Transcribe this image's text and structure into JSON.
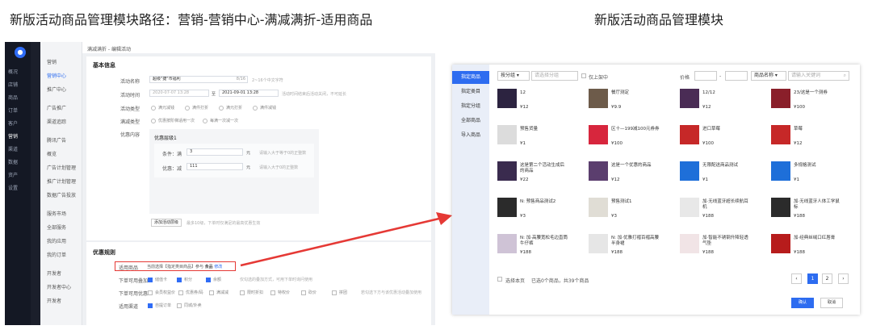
{
  "titles": {
    "left": "新版活动商品管理模块路径：营销-营销中心-满减满折-适用商品",
    "right": "新版活动商品管理模块"
  },
  "left": {
    "nav": [
      "概况",
      "店铺",
      "商品",
      "订单",
      "客户",
      "营销",
      "渠道",
      "数据",
      "资产",
      "设置"
    ],
    "nav_active": 5,
    "sub": [
      "营销",
      "营销中心",
      "推广中心",
      "广告推广",
      "渠道追踪",
      "腾讯广告",
      "概览",
      "广告计划管理",
      "推广计划管理",
      "数据广告投放",
      "服务市场",
      "全部服务",
      "我的应用",
      "我的订单",
      "开发者",
      "开发者中心",
      "开发者"
    ],
    "breadcrumb": "满减满折 - 编辑活动",
    "basic": {
      "header": "基本信息",
      "name_label": "活动名称",
      "name_value": "超级\"捷\"市福利",
      "name_count": "8/16",
      "name_hint": "2~16个中文字符",
      "time_label": "活动时间",
      "time_start": "2020-07-07 13:28",
      "time_end": "2021-09-01 13:28",
      "time_sep": "至",
      "time_hint": "活动时间结束后活动关闭，不可延长",
      "type_label": "活动类型",
      "type_opts": [
        "满元减钱",
        "满件打折",
        "满元打折",
        "满件减钱"
      ],
      "rule_label": "满减类型",
      "rule_opts": [
        "优惠按阶梯适用一次",
        "每满一次减一次"
      ],
      "promo_label": "优惠内容",
      "tier": "优惠层级1",
      "cond_label": "条件：满",
      "cond_value": "3",
      "cond_unit": "元",
      "cond_hint": "请输入大于等于0的正整数",
      "disc_label": "优惠：减",
      "disc_value": "111",
      "disc_unit": "元",
      "disc_hint": "请输入大于0的正整数",
      "add_tier": "添加活动层级",
      "add_hint": "最多10级，下单时仅满足的最高优惠生效"
    },
    "rules": {
      "header": "优惠规则",
      "goods_label": "适用商品",
      "goods_text": "当前选择【指定类目商品】参与",
      "goods_strong": "食品",
      "goods_edit": "修改",
      "stack_label": "下单可用叠加",
      "stack_opts": [
        "储值卡",
        "积分",
        "余额"
      ],
      "stack_hint": "仅勾选的叠加方式，可用下单时询问使用",
      "share_label": "下单可用优惠",
      "share_opts": [
        "会员权益价",
        "优惠券/码",
        "满减减",
        "限时折扣",
        "特权价",
        "砍价",
        "拼团"
      ],
      "share_hint": "若勾选下方与该优惠活动叠加使用",
      "chan_label": "适用渠道",
      "chan_opts": [
        "自提订单",
        "同城/外卖"
      ]
    }
  },
  "right": {
    "tabs": [
      "指定商品",
      "指定类目",
      "指定分组",
      "全部商品",
      "导入商品"
    ],
    "tab_active": 0,
    "filter_group": "按分组",
    "filter_group_ph": "请选择分组",
    "filter_only": "仅上架中",
    "price_label": "价格",
    "price_sep": "-",
    "name_select": "商品名称",
    "search_ph": "请输入关键词",
    "products": [
      {
        "name": "12",
        "price": "¥12",
        "color": "#2c2340"
      },
      {
        "name": "餐厅测定",
        "price": "¥9.9",
        "color": "#6d5b4a"
      },
      {
        "name": "12/12",
        "price": "¥12",
        "color": "#4a2c55"
      },
      {
        "name": "23/这是一个测券",
        "price": "¥100",
        "color": "#8a1f2a"
      },
      {
        "name": "预售货量",
        "price": "¥1",
        "color": "#dcdcdc"
      },
      {
        "name": "区十—199减100元券券",
        "price": "¥100",
        "color": "#d7263d"
      },
      {
        "name": "进口草莓",
        "price": "¥100",
        "color": "#c62828"
      },
      {
        "name": "草莓",
        "price": "¥12",
        "color": "#c62828"
      },
      {
        "name": "这是第二个活动生成后的商品",
        "price": "¥22",
        "color": "#3a2b4e"
      },
      {
        "name": "这是一个优惠的商品",
        "price": "¥12",
        "color": "#5b3e6e"
      },
      {
        "name": "无限配送商品测试",
        "price": "¥1",
        "color": "#1e6fd9"
      },
      {
        "name": "多规格测试",
        "price": "¥1",
        "color": "#1e6fd9"
      },
      {
        "name": "N: 预售商品测试2",
        "price": "¥3",
        "color": "#2b2b2b"
      },
      {
        "name": "预售测试1",
        "price": "¥3",
        "color": "#e0ddd5"
      },
      {
        "name": "加·无线蓝牙超长续航耳机",
        "price": "¥188",
        "color": "#e8e8e8"
      },
      {
        "name": "加·无线蓝牙人体工学鼠标",
        "price": "¥188",
        "color": "#2b2b2b"
      },
      {
        "name": "N: 加·高腰宽松毛边直筒牛仔裤",
        "price": "¥188",
        "color": "#cfc3d6"
      },
      {
        "name": "N: 加·优雅打褶百褶高腰半身裙",
        "price": "¥188",
        "color": "#e6e6e6"
      },
      {
        "name": "加·智能不锈钢升降轻透气垫",
        "price": "¥188",
        "color": "#f1e4e6"
      },
      {
        "name": "加·经典丝绒口红唇膏",
        "price": "¥188",
        "color": "#b71c1c"
      }
    ],
    "select_page": "选择本页",
    "selected": "已选0个商品，共39个商品",
    "pages": [
      "1",
      "2"
    ],
    "page_active": "1",
    "confirm": "确认",
    "cancel": "取消"
  }
}
